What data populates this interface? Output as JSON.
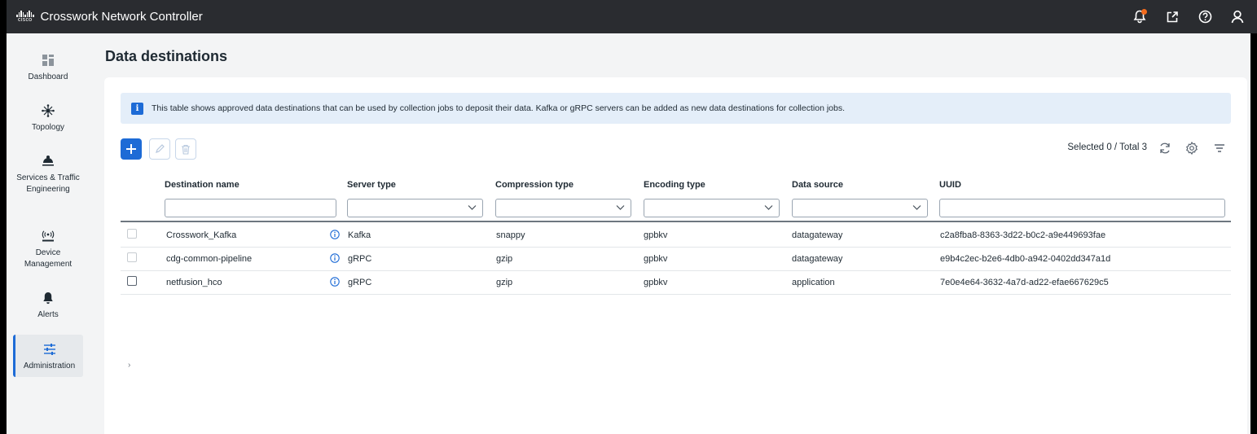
{
  "header": {
    "logo_text": "cisco",
    "app_title": "Crosswork Network Controller",
    "icons": [
      "bell-icon",
      "external-link-icon",
      "help-icon",
      "user-icon"
    ],
    "notification_color": "#f26b1d"
  },
  "sidebar": {
    "items": [
      {
        "label": "Dashboard",
        "icon": "dashboard-icon",
        "active": false
      },
      {
        "label": "Topology",
        "icon": "topology-icon",
        "active": false
      },
      {
        "label": "Services & Traffic Engineering",
        "icon": "services-icon",
        "active": false
      },
      {
        "label": "Device Management",
        "icon": "device-icon",
        "active": false
      },
      {
        "label": "Alerts",
        "icon": "bell-icon",
        "active": false
      },
      {
        "label": "Administration",
        "icon": "admin-icon",
        "active": true
      }
    ]
  },
  "page": {
    "title": "Data destinations",
    "banner": "This table shows approved data destinations that can be used by collection jobs to deposit their data. Kafka or gRPC servers can be added as new data destinations for collection jobs.",
    "selected_total": "Selected 0 / Total 3",
    "collapse_glyph": "›"
  },
  "table": {
    "columns": [
      "Destination name",
      "Server type",
      "Compression type",
      "Encoding type",
      "Data source",
      "UUID"
    ],
    "rows": [
      {
        "name": "Crosswork_Kafka",
        "server": "Kafka",
        "compression": "snappy",
        "encoding": "gpbkv",
        "source": "datagateway",
        "uuid": "c2a8fba8-8363-3d22-b0c2-a9e449693fae"
      },
      {
        "name": "cdg-common-pipeline",
        "server": "gRPC",
        "compression": "gzip",
        "encoding": "gpbkv",
        "source": "datagateway",
        "uuid": "e9b4c2ec-b2e6-4db0-a942-0402dd347a1d"
      },
      {
        "name": "netfusion_hco",
        "server": "gRPC",
        "compression": "gzip",
        "encoding": "gpbkv",
        "source": "application",
        "uuid": "7e0e4e64-3632-4a7d-ad22-efae667629c5"
      }
    ]
  },
  "colors": {
    "accent": "#1d6bd6",
    "topbar": "#2a2c30",
    "banner": "#e4eef9"
  }
}
